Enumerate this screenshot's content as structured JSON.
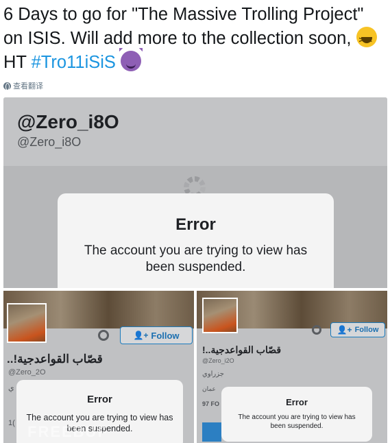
{
  "tweet": {
    "text_part1": "6 Days to go for \"The Massive Trolling Project\" on ISIS. Will add more to the collection soon, ",
    "text_part2": " HT ",
    "hashtag": "#Tro11iSiS",
    "emoji1": "laughing-emoji",
    "emoji2": "smiling-devil-emoji",
    "hashtag_color": "#1b95e0"
  },
  "translate_label": "查看翻译",
  "screenshot_top": {
    "display_name": "@Zero_i8O",
    "handle": "@Zero_i8O",
    "error_title": "Error",
    "error_message": "The account you are trying to view has been suspended."
  },
  "screenshot_left": {
    "follow_label": "Follow",
    "arabic_name": "قصّاب القواعدجية!..",
    "handle": "@Zero_2O",
    "extra_text": "ي",
    "number_text": "1(",
    "error_title": "Error",
    "error_message": "The account you are trying to view has been suspended.",
    "watermark": "FREEBUF"
  },
  "screenshot_right": {
    "follow_label": "Follow",
    "arabic_name": "قصّاب القواعدجية..!",
    "handle": "@Zero_i2O",
    "bio": "جزراوي",
    "location": "عمان",
    "count_text": "97 FO",
    "error_title": "Error",
    "error_message": "The account you are trying to view has been suspended."
  }
}
